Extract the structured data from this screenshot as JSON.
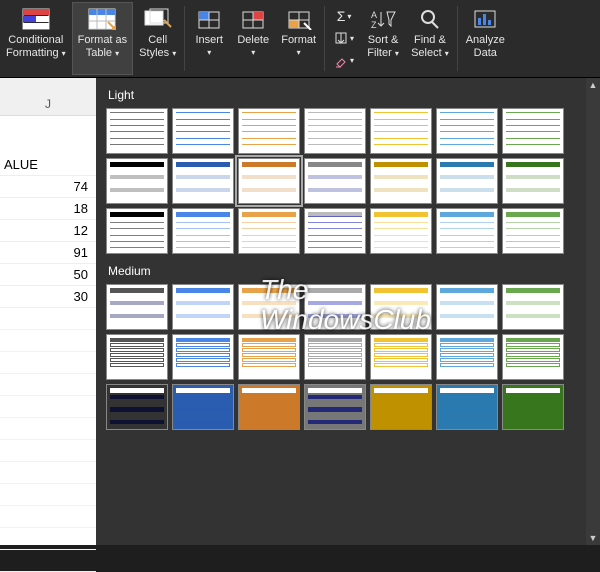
{
  "ribbon": {
    "buttons": [
      {
        "label1": "Conditional",
        "label2": "Formatting",
        "drop": true
      },
      {
        "label1": "Format as",
        "label2": "Table",
        "drop": true,
        "active": true
      },
      {
        "label1": "Cell",
        "label2": "Styles",
        "drop": true
      },
      {
        "label1": "Insert",
        "label2": "",
        "drop": true
      },
      {
        "label1": "Delete",
        "label2": "",
        "drop": true
      },
      {
        "label1": "Format",
        "label2": "",
        "drop": true
      },
      {
        "label1": "Sort &",
        "label2": "Filter",
        "drop": true
      },
      {
        "label1": "Find &",
        "label2": "Select",
        "drop": true
      },
      {
        "label1": "Analyze",
        "label2": "Data",
        "drop": false
      }
    ]
  },
  "sheet": {
    "col": "J",
    "header": "ALUE",
    "values": [
      "74",
      "18",
      "12",
      "91",
      "50",
      "30"
    ]
  },
  "gallery": {
    "sections": [
      {
        "title": "Light",
        "rows": 3,
        "cols": 7,
        "palette": [
          [
            "#777",
            "#4a86e8",
            "#e8a24a",
            "#bbb",
            "#f1c232",
            "#5fa8dd",
            "#6aa84f"
          ],
          [
            "#000",
            "#2a5db0",
            "#cc7a29",
            "#888",
            "#bf9000",
            "#2a7ab0",
            "#38761d"
          ],
          [
            "#000",
            "#4a86e8",
            "#e8a24a",
            "#bbb",
            "#f1c232",
            "#5fa8dd",
            "#6aa84f"
          ]
        ],
        "styles": [
          "outline",
          "banded",
          "header-solid"
        ]
      },
      {
        "title": "Medium",
        "rows": 3,
        "cols": 7,
        "palette": [
          [
            "#555",
            "#4a86e8",
            "#e8a24a",
            "#aaa",
            "#f1c232",
            "#5fa8dd",
            "#6aa84f"
          ],
          [
            "#555",
            "#4a86e8",
            "#e8a24a",
            "#aaa",
            "#f1c232",
            "#5fa8dd",
            "#6aa84f"
          ],
          [
            "#333",
            "#2a5db0",
            "#cc7a29",
            "#777",
            "#bf9000",
            "#2a7ab0",
            "#38761d"
          ]
        ],
        "styles": [
          "hdr-banded",
          "outline-bold",
          "solid"
        ]
      }
    ]
  },
  "watermark": {
    "line1": "The",
    "line2": "WindowsClub"
  }
}
